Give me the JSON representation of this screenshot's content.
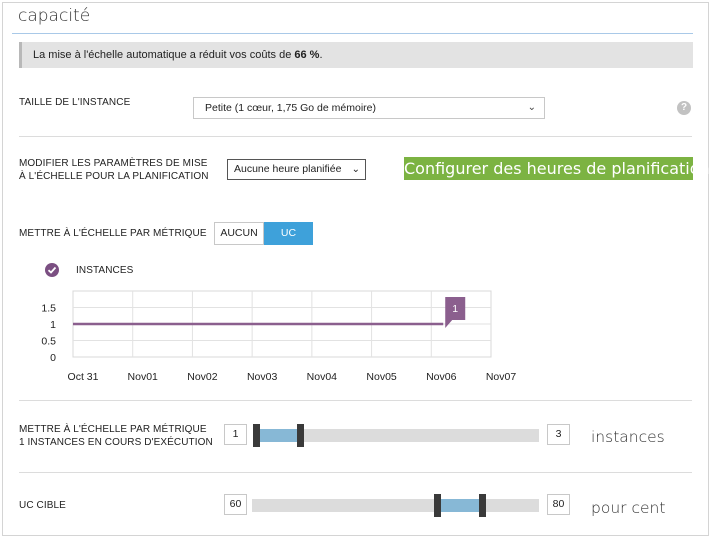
{
  "header": {
    "title": "capacité"
  },
  "info": {
    "prefix": "La mise à l'échelle automatique a réduit vos coûts de ",
    "value": "66 %",
    "suffix": "."
  },
  "instance_size": {
    "label": "TAILLE DE L'INSTANCE",
    "selected": "Petite (1 cœur, 1,75 Go de mémoire)",
    "help_icon": "?"
  },
  "schedule": {
    "label_line1": "MODIFIER LES PARAMÈTRES DE MISE",
    "label_line2": "À L'ÉCHELLE POUR LA PLANIFICATION",
    "selected": "Aucune heure planifiée",
    "configure_button": "Configurer des heures de planification"
  },
  "metric": {
    "label": "METTRE À L'ÉCHELLE PAR MÉTRIQUE",
    "options": [
      "AUCUN",
      "UC"
    ],
    "selected": "UC"
  },
  "chart_legend": {
    "label": "INSTANCES",
    "checked": true,
    "color": "#7b4f82"
  },
  "chart_data": {
    "type": "line",
    "x": [
      "Oct 31",
      "Nov01",
      "Nov02",
      "Nov03",
      "Nov04",
      "Nov05",
      "Nov06",
      "Nov07"
    ],
    "y_ticks": [
      "1.5",
      "1",
      "0.5",
      "0"
    ],
    "ylim": [
      0,
      2
    ],
    "series": [
      {
        "name": "INSTANCES",
        "color": "#8b5f8e",
        "points": [
          [
            0,
            1
          ],
          [
            6.2,
            1
          ]
        ],
        "end_label": "1"
      }
    ],
    "grid": true
  },
  "instances_range": {
    "label_line1": "METTRE À L'ÉCHELLE PAR MÉTRIQUE",
    "label_line2": "1 INSTANCES EN COURS D'EXÉCUTION",
    "min_label": "1",
    "max_label": "3",
    "range_low": 1,
    "range_high": 2,
    "unit": "instances"
  },
  "target_cpu": {
    "label": "UC CIBLE",
    "min_label": "60",
    "max_label": "80",
    "range_low": 60,
    "range_high": 80,
    "unit": "pour cent"
  },
  "colors": {
    "accent_blue": "#3ea1da",
    "green": "#7cb342",
    "purple": "#7b4f82"
  }
}
